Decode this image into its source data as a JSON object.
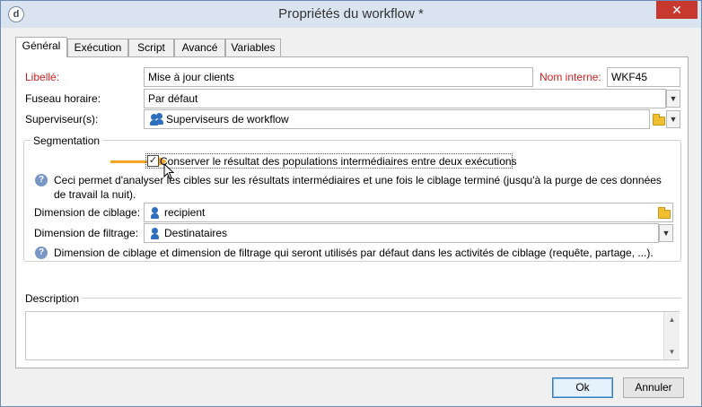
{
  "window": {
    "title": "Propriétés du workflow *",
    "close_label": "✕",
    "app_icon": "d"
  },
  "tabs": [
    {
      "label": "Général",
      "active": true
    },
    {
      "label": "Exécution",
      "active": false
    },
    {
      "label": "Script",
      "active": false
    },
    {
      "label": "Avancé",
      "active": false
    },
    {
      "label": "Variables",
      "active": false
    }
  ],
  "general": {
    "libelle_label": "Libellé:",
    "libelle_value": "Mise à jour clients",
    "nom_interne_label": "Nom interne:",
    "nom_interne_value": "WKF45",
    "fuseau_label": "Fuseau horaire:",
    "fuseau_value": "Par défaut",
    "superviseur_label": "Superviseur(s):",
    "superviseur_value": "Superviseurs de workflow"
  },
  "segmentation": {
    "title": "Segmentation",
    "checkbox_label": "Conserver le résultat des populations intermédiaires entre deux exécutions",
    "checkbox_checked": true,
    "help_text": "Ceci permet d'analyser les cibles sur les résultats intermédiaires et une fois le ciblage terminé (jusqu'à la purge de ces données de travail la nuit).",
    "ciblage_label": "Dimension de ciblage:",
    "ciblage_value": "recipient",
    "filtrage_label": "Dimension de filtrage:",
    "filtrage_value": "Destinataires",
    "help_text_2": "Dimension de ciblage et dimension de filtrage qui seront utilisés par défaut dans les activités de ciblage (requête, partage, ...)."
  },
  "description": {
    "title": "Description",
    "value": ""
  },
  "buttons": {
    "ok_label": "Ok",
    "cancel_label": "Annuler"
  },
  "colors": {
    "required_label": "#d21f1f",
    "arrow": "#f5a623",
    "close_button": "#c7392f"
  }
}
